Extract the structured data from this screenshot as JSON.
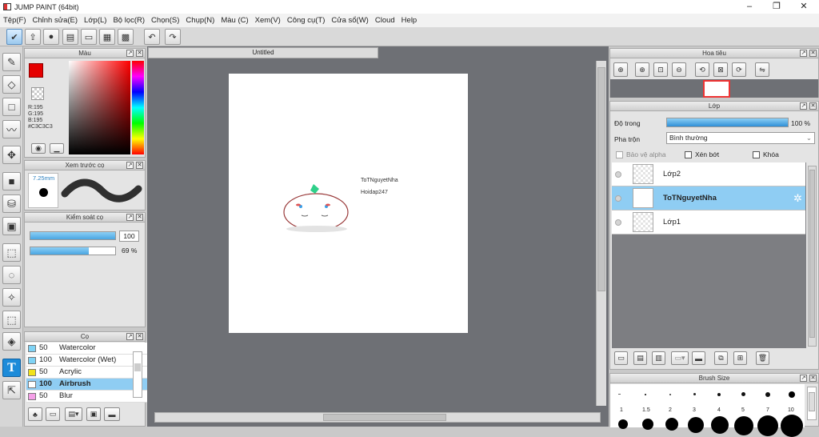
{
  "window": {
    "title": "JUMP PAINT (64bit)",
    "minimize": "–",
    "maximize": "❐",
    "close": "✕"
  },
  "menu": [
    "Tệp(F)",
    "Chỉnh sửa(E)",
    "Lớp(L)",
    "Bộ lọc(R)",
    "Chọn(S)",
    "Chụp(N)",
    "Màu (C)",
    "Xem(V)",
    "Công cụ(T)",
    "Cửa sổ(W)",
    "Cloud",
    "Help"
  ],
  "color_panel": {
    "title": "Màu",
    "r": "R:195",
    "g": "G:195",
    "b": "B:195",
    "hex": "#C3C3C3"
  },
  "brush_preview": {
    "title": "Xem trước cọ",
    "size": "7.25mm"
  },
  "brush_control": {
    "title": "Kiểm soát cọ",
    "size_value": "100",
    "density_value": "69 %",
    "size_fraction": 1.0,
    "density_fraction": 0.69
  },
  "brush_list": {
    "title": "Cọ",
    "items": [
      {
        "size": "50",
        "name": "Watercolor",
        "color": "#7fd3f5"
      },
      {
        "size": "100",
        "name": "Watercolor (Wet)",
        "color": "#7fd3f5"
      },
      {
        "size": "50",
        "name": "Acrylic",
        "color": "#f2e21a"
      },
      {
        "size": "100",
        "name": "Airbrush",
        "color": "#ffffff",
        "selected": true
      },
      {
        "size": "50",
        "name": "Blur",
        "color": "#f5a0e8"
      }
    ]
  },
  "document": {
    "tab": "Untitled",
    "text1": "ToTNguyetNha",
    "text2": "Hoidap247"
  },
  "navigator": {
    "title": "Hoa tiêu"
  },
  "layers": {
    "title": "Lớp",
    "opacity_label": "Độ trong",
    "opacity_value": "100 %",
    "opacity_fraction": 1.0,
    "blend_label": "Pha trộn",
    "blend_value": "Bình thường",
    "protect_alpha": "Bảo vệ alpha",
    "clipping": "Xén bớt",
    "lock": "Khóa",
    "items": [
      {
        "name": "Lớp2",
        "selected": false
      },
      {
        "name": "ToTNguyetNha",
        "selected": true
      },
      {
        "name": "Lớp1",
        "selected": false
      }
    ]
  },
  "brush_size": {
    "title": "Brush Size",
    "sizes": [
      "1",
      "1.5",
      "2",
      "3",
      "4",
      "5",
      "7",
      "10"
    ]
  }
}
